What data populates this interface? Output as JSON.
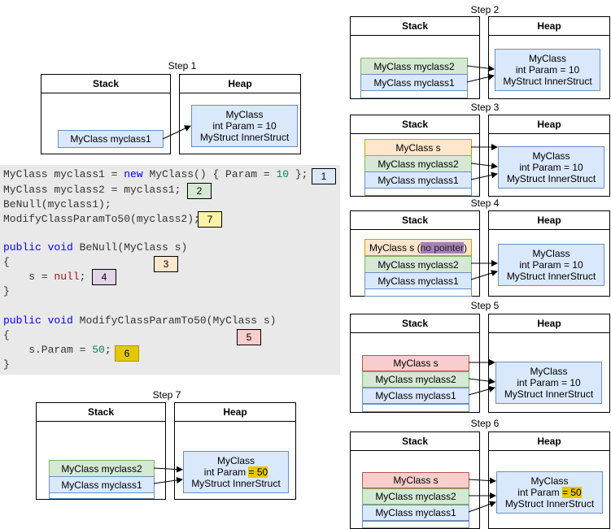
{
  "headers": {
    "stack": "Stack",
    "heap": "Heap"
  },
  "steps": {
    "s1": "Step 1",
    "s2": "Step 2",
    "s3": "Step 3",
    "s4": "Step 4",
    "s5": "Step 5",
    "s6": "Step 6",
    "s7": "Step 7"
  },
  "cells": {
    "myclass1": "MyClass myclass1",
    "myclass2": "MyClass myclass2",
    "s": "MyClass s",
    "s_prefix": "MyClass s (",
    "no_pointer": "no pointer",
    "s_suffix": ")"
  },
  "heap": {
    "line1": "MyClass",
    "line2": "int Param = 10",
    "line3": "MyStruct InnerStruct",
    "line2_prefix": "int Param ",
    "line2_value": "= 50"
  },
  "code": {
    "l1_a": "MyClass myclass1 = ",
    "l1_new": "new",
    "l1_b": " MyClass() { Param = ",
    "l1_num": "10",
    "l1_c": " };",
    "l2": "MyClass myclass2 = myclass1;",
    "l3": "BeNull(myclass1);",
    "l4": "ModifyClassParamTo50(myclass2);",
    "l6_public": "public",
    "l6_void": "void",
    "l6_rest": " BeNull(MyClass s)",
    "brace_open": "{",
    "l8_a": "    s = ",
    "l8_null": "null",
    "l8_b": ";",
    "brace_close": "}",
    "l11_rest": " ModifyClassParamTo50(MyClass s)",
    "l13_a": "    s.Param = ",
    "l13_num": "50",
    "l13_b": ";"
  },
  "badges": {
    "b1": "1",
    "b2": "2",
    "b3": "3",
    "b4": "4",
    "b5": "5",
    "b6": "6",
    "b7": "7"
  },
  "colors": {
    "blue_fill": "#dae8fc",
    "green_fill": "#d5e8d4",
    "orange_fill": "#ffe6cc",
    "red_fill": "#f8cecc",
    "purple_fill": "#e1d5e7",
    "yellow_fill": "#fff2cc",
    "highlight": "#e6c700",
    "code_bg": "#e9e9e9"
  }
}
